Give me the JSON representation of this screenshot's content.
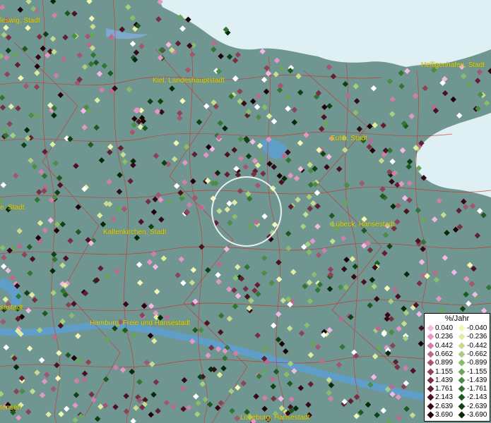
{
  "places": [
    {
      "key": "schleswig",
      "text": "leswig, Stadt"
    },
    {
      "key": "kiel",
      "text": "Kiel, Landeshauptstadt"
    },
    {
      "key": "heiligenhafen",
      "text": "Heiligenhafen, Stadt"
    },
    {
      "key": "eutin",
      "text": "Eutin, Stadt"
    },
    {
      "key": "left_stadt",
      "text": "e, Stadt"
    },
    {
      "key": "kaltenkirchen",
      "text": "Kaltenkirchen, Stadt"
    },
    {
      "key": "luebeck",
      "text": "Lübeck, Hansestadt"
    },
    {
      "key": "left_hansestadt",
      "text": "sestadt"
    },
    {
      "key": "hamburg",
      "text": "Hamburg, Freie und Hansestadt"
    },
    {
      "key": "lueneburg",
      "text": "Lüneburg, Hansestadt"
    },
    {
      "key": "left_tensen",
      "text": "tensen"
    }
  ],
  "legend": {
    "title": "%/Jahr",
    "rows": [
      {
        "pos": "0.040",
        "neg": "-0.040",
        "pos_color": "#f4b8e6",
        "neg_color": "#f2f7b8"
      },
      {
        "pos": "0.236",
        "neg": "-0.236",
        "pos_color": "#e597c4",
        "neg_color": "#e1eca3"
      },
      {
        "pos": "0.442",
        "neg": "-0.442",
        "pos_color": "#d07fa8",
        "neg_color": "#c7dc8f"
      },
      {
        "pos": "0.662",
        "neg": "-0.662",
        "pos_color": "#b96b8e",
        "neg_color": "#a9ce7e"
      },
      {
        "pos": "0.899",
        "neg": "-0.899",
        "pos_color": "#a3566f",
        "neg_color": "#8abd6b"
      },
      {
        "pos": "1.155",
        "neg": "-1.155",
        "pos_color": "#8c4358",
        "neg_color": "#69a55a"
      },
      {
        "pos": "1.439",
        "neg": "-1.439",
        "pos_color": "#773043",
        "neg_color": "#4b8c46"
      },
      {
        "pos": "1.761",
        "neg": "-1.761",
        "pos_color": "#621f32",
        "neg_color": "#327434"
      },
      {
        "pos": "2.143",
        "neg": "-2.143",
        "pos_color": "#4d1122",
        "neg_color": "#1d5a22"
      },
      {
        "pos": "2.639",
        "neg": "-2.639",
        "pos_color": "#370815",
        "neg_color": "#0e4214"
      },
      {
        "pos": "3.690",
        "neg": "-3.690",
        "pos_color": "#200309",
        "neg_color": "#052a09"
      }
    ]
  },
  "colors": {
    "land": "#6f9690",
    "water": "#dff0f4",
    "river": "#5f9ec9",
    "boundary": "#d42a2a",
    "label": "#e8d400"
  }
}
